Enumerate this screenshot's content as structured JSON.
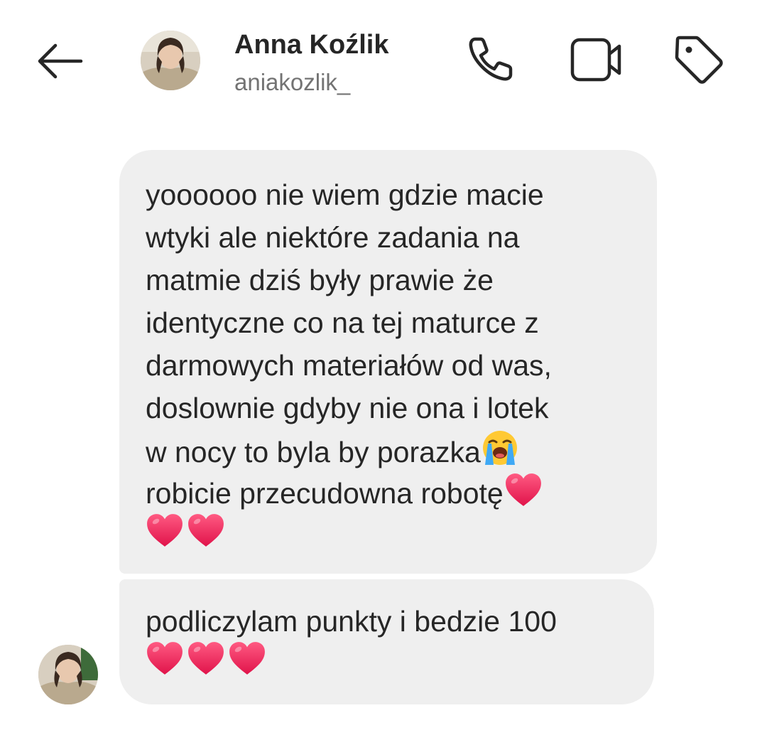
{
  "header": {
    "name": "Anna Koźlik",
    "username": "aniakozlik_",
    "back_icon": "arrow-left-icon",
    "avatar": "profile-photo",
    "actions": [
      {
        "id": "call",
        "icon": "phone-icon"
      },
      {
        "id": "video",
        "icon": "video-camera-icon"
      },
      {
        "id": "tag",
        "icon": "tag-icon"
      }
    ]
  },
  "messages": [
    {
      "lines": [
        "yoooooo nie wiem gdzie macie",
        "wtyki ale niektóre zadania na",
        "matmie dziś były prawie że",
        "identyczne co na tej maturce z",
        "darmowych materiałów od was,",
        "doslownie gdyby nie ona i lotek",
        "w nocy to byla by porazka",
        "robicie przecudowna robotę"
      ],
      "inline_emojis": [
        "loudly-crying-face",
        "red-heart"
      ],
      "trailing_emojis": [
        "red-heart",
        "red-heart"
      ]
    },
    {
      "lines": [
        "podliczylam punkty i bedzie 100"
      ],
      "trailing_emojis": [
        "red-heart",
        "red-heart",
        "red-heart"
      ]
    }
  ],
  "colors": {
    "bubble": "#efefef",
    "text": "#262626",
    "secondary_text": "#737373",
    "heart": "#f5325f"
  }
}
